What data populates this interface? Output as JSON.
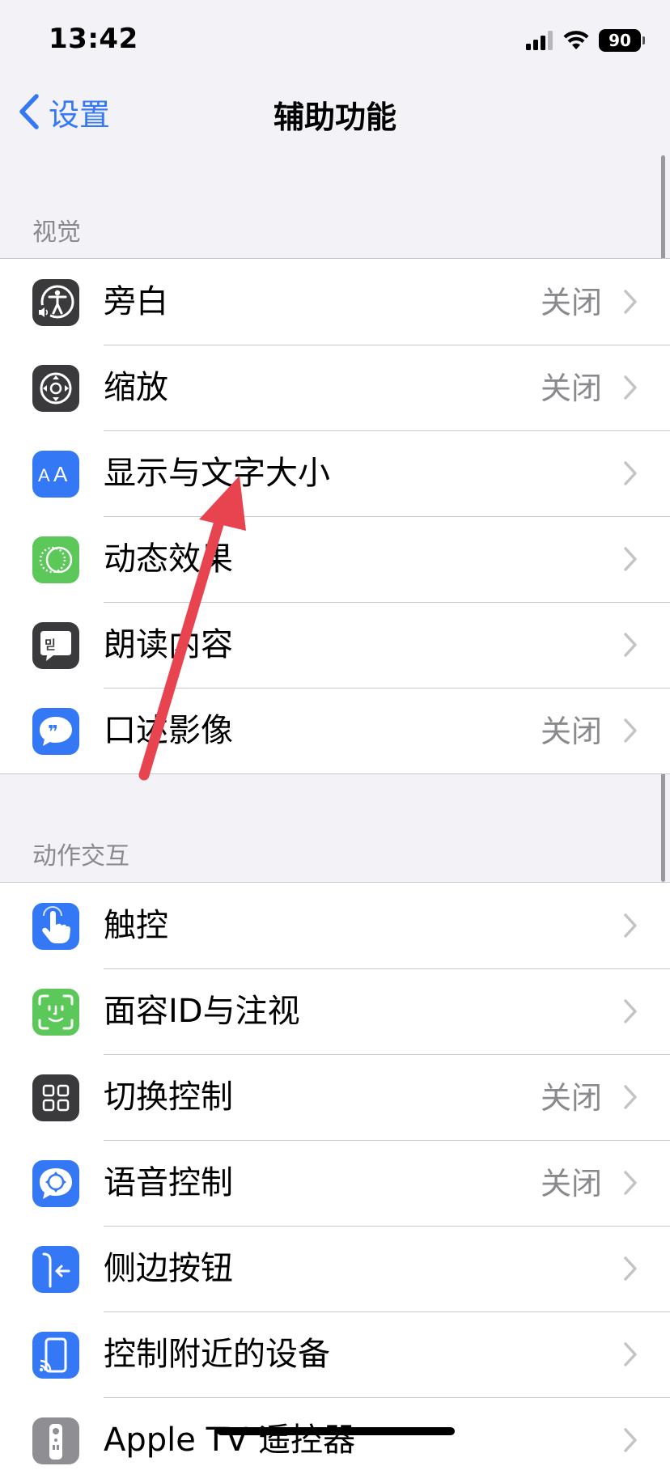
{
  "status_bar": {
    "time": "13:42",
    "battery": "90"
  },
  "nav": {
    "back_label": "设置",
    "title": "辅助功能"
  },
  "sections": [
    {
      "header": "视觉",
      "items": [
        {
          "icon": "voiceover-icon",
          "icon_color": "#3a3a3c",
          "label": "旁白",
          "value": "关闭"
        },
        {
          "icon": "zoom-icon",
          "icon_color": "#3a3a3c",
          "label": "缩放",
          "value": "关闭"
        },
        {
          "icon": "text-size-icon",
          "icon_color": "#3478f6",
          "label": "显示与文字大小",
          "value": ""
        },
        {
          "icon": "motion-icon",
          "icon_color": "#5cc85a",
          "label": "动态效果",
          "value": ""
        },
        {
          "icon": "spoken-content-icon",
          "icon_color": "#3a3a3c",
          "label": "朗读内容",
          "value": ""
        },
        {
          "icon": "audio-description-icon",
          "icon_color": "#3478f6",
          "label": "口述影像",
          "value": "关闭"
        }
      ]
    },
    {
      "header": "动作交互",
      "items": [
        {
          "icon": "touch-icon",
          "icon_color": "#3478f6",
          "label": "触控",
          "value": ""
        },
        {
          "icon": "face-id-icon",
          "icon_color": "#5cc85a",
          "label": "面容ID与注视",
          "value": ""
        },
        {
          "icon": "switch-control-icon",
          "icon_color": "#3a3a3c",
          "label": "切换控制",
          "value": "关闭"
        },
        {
          "icon": "voice-control-icon",
          "icon_color": "#3478f6",
          "label": "语音控制",
          "value": "关闭"
        },
        {
          "icon": "side-button-icon",
          "icon_color": "#3478f6",
          "label": "侧边按钮",
          "value": ""
        },
        {
          "icon": "nearby-devices-icon",
          "icon_color": "#3478f6",
          "label": "控制附近的设备",
          "value": ""
        },
        {
          "icon": "apple-tv-remote-icon",
          "icon_color": "#8e8e93",
          "label": "Apple TV 遥控器",
          "value": ""
        }
      ]
    }
  ],
  "colors": {
    "accent": "#3478f6",
    "annotation_arrow": "#e84450"
  }
}
